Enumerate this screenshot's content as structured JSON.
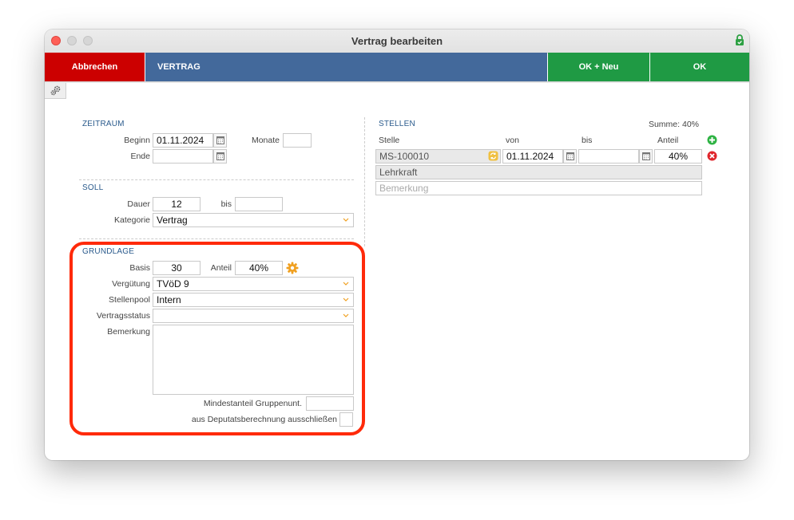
{
  "window": {
    "title": "Vertrag bearbeiten"
  },
  "toolbar": {
    "cancel_label": "Abbrechen",
    "section_label": "VERTRAG",
    "ok_new_label": "OK + Neu",
    "ok_label": "OK"
  },
  "zeitraum": {
    "title": "ZEITRAUM",
    "beginn_label": "Beginn",
    "beginn_value": "01.11.2024",
    "monate_label": "Monate",
    "monate_value": "",
    "ende_label": "Ende",
    "ende_value": ""
  },
  "soll": {
    "title": "SOLL",
    "dauer_label": "Dauer",
    "dauer_value": "12",
    "bis_label": "bis",
    "bis_value": "",
    "kategorie_label": "Kategorie",
    "kategorie_value": "Vertrag"
  },
  "grundlage": {
    "title": "GRUNDLAGE",
    "basis_label": "Basis",
    "basis_value": "30",
    "anteil_label": "Anteil",
    "anteil_value": "40%",
    "verguetung_label": "Vergütung",
    "verguetung_value": "TVöD 9",
    "stellenpool_label": "Stellenpool",
    "stellenpool_value": "Intern",
    "vertragsstatus_label": "Vertragsstatus",
    "vertragsstatus_value": "",
    "bemerkung_label": "Bemerkung",
    "bemerkung_value": "",
    "mindestanteil_label": "Mindestanteil Gruppenunt.",
    "mindestanteil_value": "",
    "deputat_label": "aus Deputatsberechnung ausschließen"
  },
  "stellen": {
    "title": "STELLEN",
    "summe": "Summe: 40%",
    "col_stelle": "Stelle",
    "col_von": "von",
    "col_bis": "bis",
    "col_anteil": "Anteil",
    "row": {
      "stelle": "MS-100010",
      "von": "01.11.2024",
      "bis": "",
      "anteil": "40%",
      "bezeichnung": "Lehrkraft",
      "bemerkung_placeholder": "Bemerkung"
    }
  },
  "colors": {
    "cancel": "#cc0000",
    "header_blue": "#43699b",
    "ok_green": "#1f9a44",
    "section_title": "#2a5a8c",
    "highlight": "#ff2a0a",
    "gear_orange": "#f0a020"
  }
}
